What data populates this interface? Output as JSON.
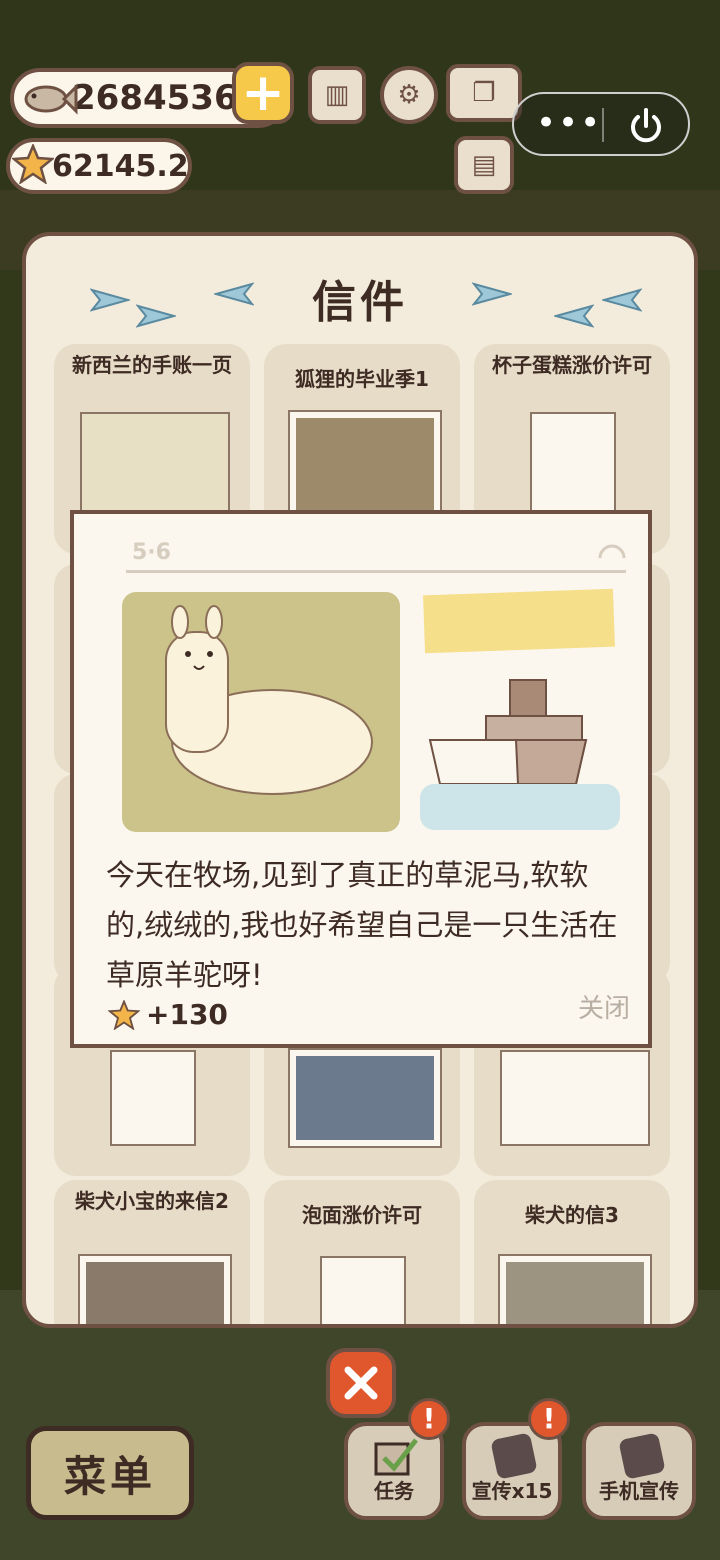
{
  "currency": {
    "fish_value": "2684536",
    "star_value": "62145.2"
  },
  "panel": {
    "title": "信件",
    "cards": [
      {
        "title": "新西兰的手账一页"
      },
      {
        "title": "狐狸的毕业季1"
      },
      {
        "title": "杯子蛋糕涨价许可"
      },
      {
        "title": "柴犬小宝的来信2"
      },
      {
        "title": "泡面涨价许可"
      },
      {
        "title": "柴犬的信3"
      }
    ]
  },
  "diary": {
    "date": "5·6",
    "text": "今天在牧场,见到了真正的草泥马,软软的,绒绒的,我也好希望自己是一只生活在草原羊驼呀!",
    "reward": "+130",
    "close_label": "关闭"
  },
  "bottom": {
    "menu_label": "菜单",
    "task_label": "任务",
    "promo_label": "宣传x15",
    "phone_promo_label": "手机宣传",
    "badge_mark": "!"
  },
  "colors": {
    "border_brown": "#6e5142",
    "panel_bg": "#f3ecdc",
    "accent_orange": "#e0572d",
    "gold": "#f7c94a"
  },
  "icons": [
    "fish-icon",
    "star-icon",
    "plus-icon",
    "ranking-icon",
    "settings-icon",
    "book-icon",
    "newspaper-icon",
    "more-icon",
    "power-icon",
    "paper-plane-icon",
    "close-icon"
  ]
}
